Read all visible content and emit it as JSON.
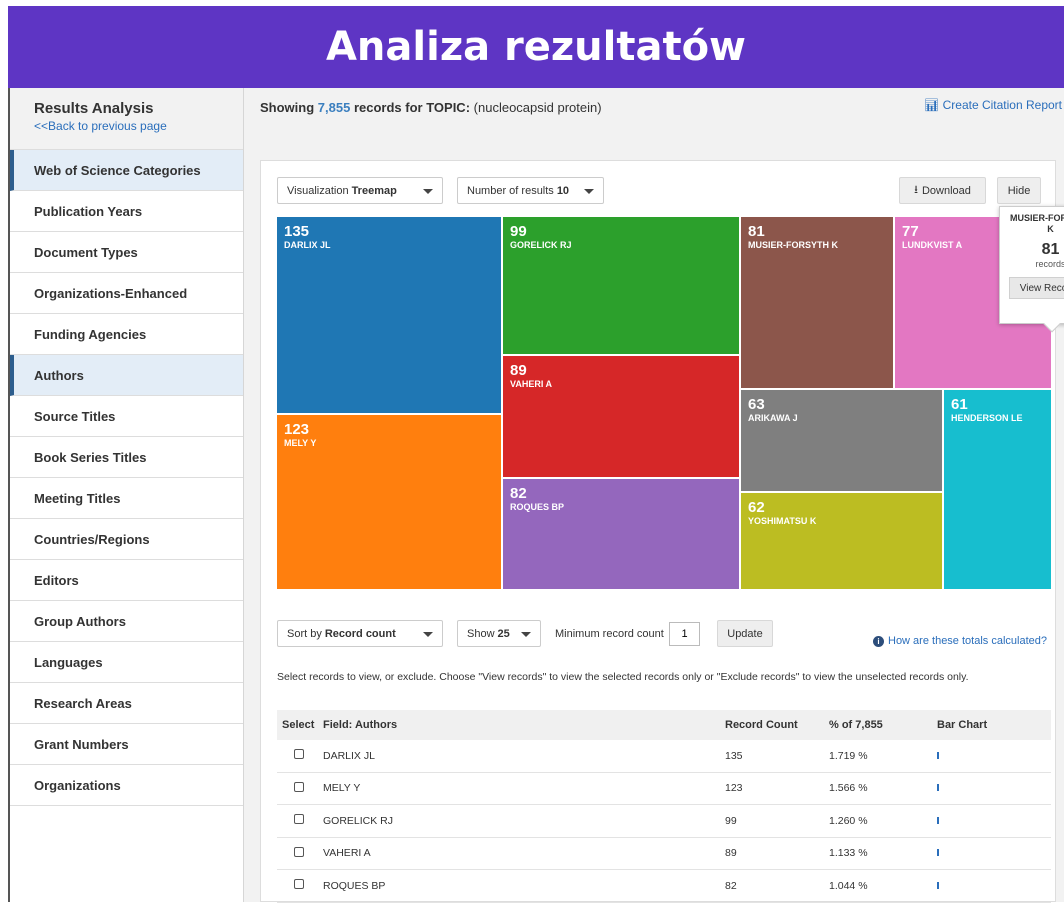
{
  "banner": {
    "title": "Analiza rezultatów"
  },
  "sidebar": {
    "title": "Results Analysis",
    "back_link": "<<Back to previous page",
    "items": [
      {
        "label": "Web of Science Categories",
        "active": true
      },
      {
        "label": "Publication Years"
      },
      {
        "label": "Document Types"
      },
      {
        "label": "Organizations-Enhanced"
      },
      {
        "label": "Funding Agencies"
      },
      {
        "label": "Authors",
        "active": true
      },
      {
        "label": "Source Titles"
      },
      {
        "label": "Book Series Titles"
      },
      {
        "label": "Meeting Titles"
      },
      {
        "label": "Countries/Regions"
      },
      {
        "label": "Editors"
      },
      {
        "label": "Group Authors"
      },
      {
        "label": "Languages"
      },
      {
        "label": "Research Areas"
      },
      {
        "label": "Grant Numbers"
      },
      {
        "label": "Organizations"
      }
    ]
  },
  "header": {
    "showing_prefix": "Showing",
    "record_count": "7,855",
    "showing_mid": "records for TOPIC:",
    "query": "(nucleocapsid protein)",
    "citation_report": "Create Citation Report"
  },
  "controls": {
    "visualization_label": "Visualization",
    "visualization_value": "Treemap",
    "num_results_label": "Number of results",
    "num_results_value": "10",
    "download": "Download",
    "hide": "Hide",
    "sort_label": "Sort by",
    "sort_value": "Record count",
    "show_label": "Show",
    "show_value": "25",
    "min_count_label": "Minimum record count",
    "min_count_value": "1",
    "update": "Update",
    "how_calculated": "How are these totals calculated?",
    "instructions": "Select records to view, or exclude. Choose \"View records\" to view the selected records only or \"Exclude records\" to view the unselected records only."
  },
  "popup": {
    "name": "MUSIER-FORSYTH K",
    "count": "81",
    "records_label": "records",
    "view_button": "View Records"
  },
  "chart_data": {
    "type": "treemap",
    "items": [
      {
        "label": "DARLIX JL",
        "value": 135,
        "color": "#1f77b4"
      },
      {
        "label": "MELY Y",
        "value": 123,
        "color": "#ff7f0e"
      },
      {
        "label": "GORELICK RJ",
        "value": 99,
        "color": "#2ca02c"
      },
      {
        "label": "VAHERI A",
        "value": 89,
        "color": "#d62728"
      },
      {
        "label": "ROQUES BP",
        "value": 82,
        "color": "#9467bd"
      },
      {
        "label": "MUSIER-FORSYTH K",
        "value": 81,
        "color": "#8c564b"
      },
      {
        "label": "LUNDKVIST A",
        "value": 77,
        "color": "#e377c2"
      },
      {
        "label": "ARIKAWA J",
        "value": 63,
        "color": "#7f7f7f"
      },
      {
        "label": "YOSHIMATSU K",
        "value": 62,
        "color": "#bcbd22"
      },
      {
        "label": "HENDERSON LE",
        "value": 61,
        "color": "#17becf"
      }
    ]
  },
  "table": {
    "headers": {
      "select": "Select",
      "field": "Field: Authors",
      "count": "Record Count",
      "pct": "% of 7,855",
      "bar": "Bar Chart"
    },
    "rows": [
      {
        "field": "DARLIX JL",
        "count": "135",
        "pct": "1.719 %"
      },
      {
        "field": "MELY Y",
        "count": "123",
        "pct": "1.566 %"
      },
      {
        "field": "GORELICK RJ",
        "count": "99",
        "pct": "1.260 %"
      },
      {
        "field": "VAHERI A",
        "count": "89",
        "pct": "1.133 %"
      },
      {
        "field": "ROQUES BP",
        "count": "82",
        "pct": "1.044 %"
      }
    ]
  }
}
